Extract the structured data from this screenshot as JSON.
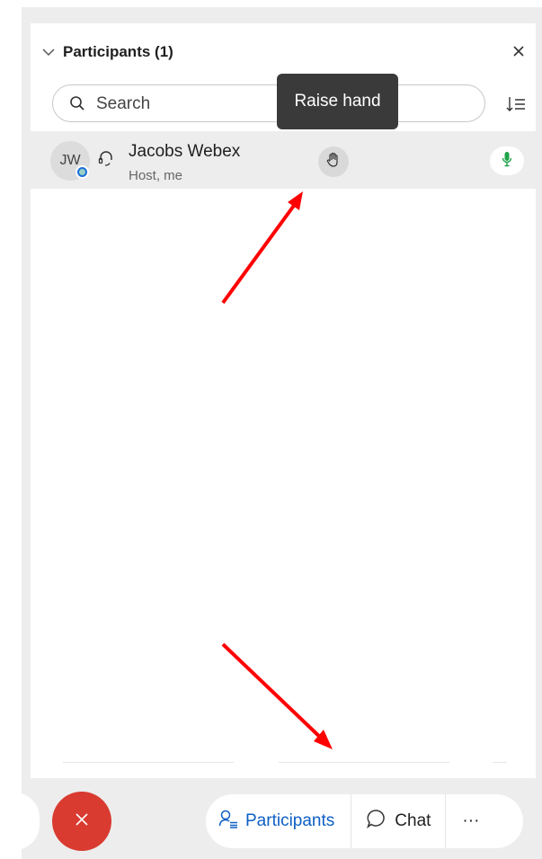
{
  "panel": {
    "title": "Participants (1)",
    "search_placeholder": "Search"
  },
  "tooltip": {
    "text": "Raise hand"
  },
  "participant": {
    "initials": "JW",
    "name": "Jacobs Webex",
    "role": "Host, me"
  },
  "bottom_bar": {
    "participants_label": "Participants",
    "chat_label": "Chat",
    "more_label": "···"
  },
  "icons": {
    "collapse": "chevron-down-icon",
    "close": "close-icon",
    "search": "search-icon",
    "sort": "sort-icon",
    "headset": "headset-icon",
    "raise_hand": "hand-icon",
    "mic": "microphone-icon",
    "leave": "close-icon",
    "participants": "participants-icon",
    "chat": "chat-bubble-icon"
  },
  "colors": {
    "accent": "#0d5fc5",
    "leave": "#d93b30",
    "mic": "#1fa34a",
    "annotation_arrow": "#ff0000",
    "tooltip_bg": "#3a3a3a"
  }
}
